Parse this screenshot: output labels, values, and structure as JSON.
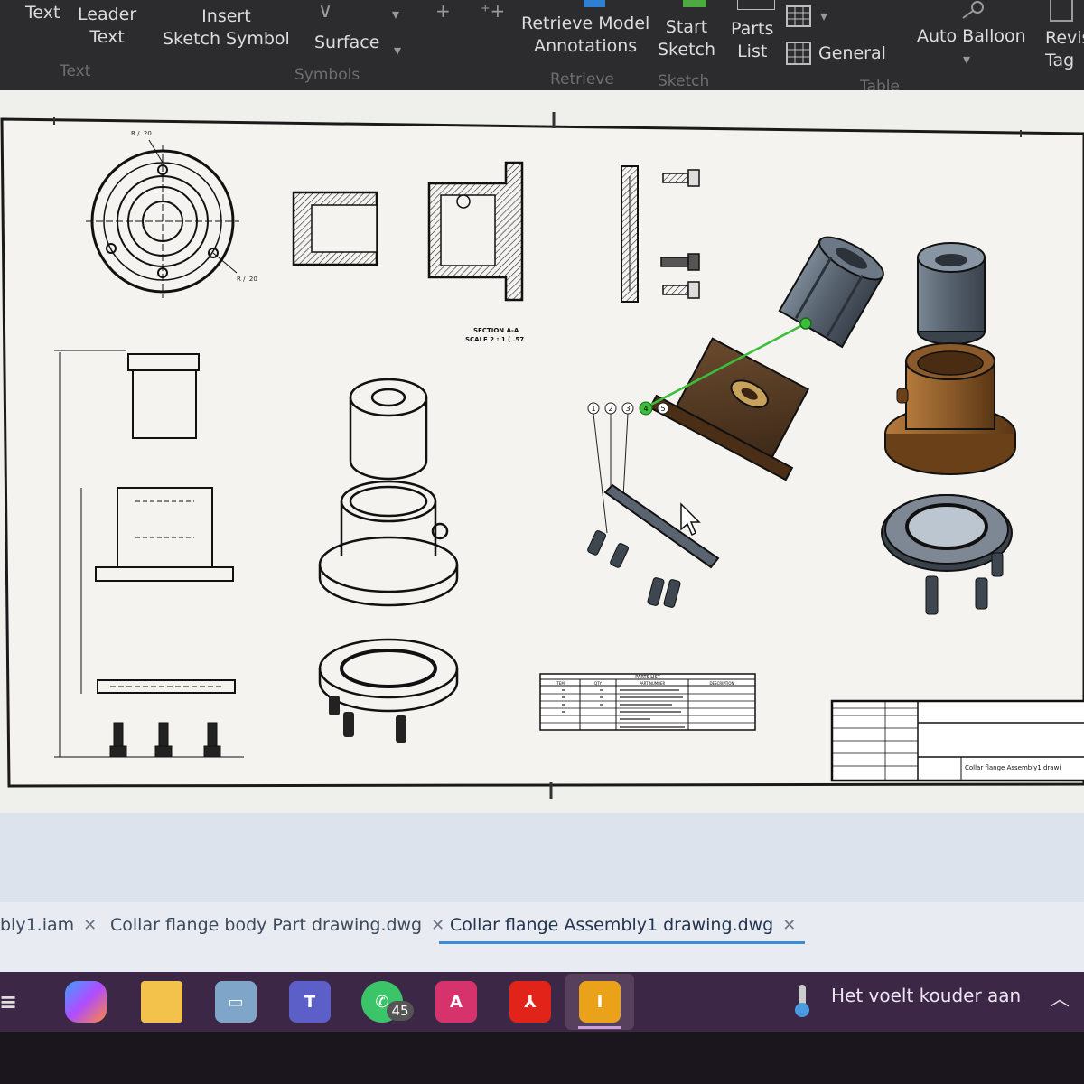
{
  "ribbon": {
    "text_label": "Text",
    "leader_text": [
      "Leader",
      "Text"
    ],
    "insert_sketch_symbol": [
      "Insert",
      "Sketch Symbol"
    ],
    "surface_label": "Surface",
    "retrieve_model_annotations": [
      "Retrieve Model",
      "Annotations"
    ],
    "start_sketch": [
      "Start",
      "Sketch"
    ],
    "parts_list": [
      "Parts",
      "List"
    ],
    "general_label": "General",
    "auto_balloon_label": "Auto Balloon",
    "revision_tag": [
      "Revis",
      "Tag"
    ],
    "groups": {
      "text": "Text",
      "symbols": "Symbols",
      "retrieve": "Retrieve",
      "sketch": "Sketch",
      "table": "Table"
    }
  },
  "drawing": {
    "section_caption": [
      "SECTION A-A",
      "SCALE 2 : 1 ( .57"
    ],
    "parts_list_title": "PARTS LIST",
    "parts_list_headers": [
      "ITEM",
      "QTY",
      "PART NUMBER",
      "DESCRIPTION"
    ],
    "title_block_name": "Collar flange Assembly1 drawi",
    "balloons": [
      "1",
      "2",
      "3",
      "4",
      "5"
    ],
    "colors": {
      "bronze": "#8a5a2a",
      "gray_part": "#55606c",
      "highlight": "#3bbf3b"
    }
  },
  "tabs": [
    {
      "label": "bly1.iam",
      "active": false
    },
    {
      "label": "Collar flange body Part drawing.dwg",
      "active": false
    },
    {
      "label": "Collar flange Assembly1 drawing.dwg",
      "active": true
    }
  ],
  "taskbar": {
    "whatsapp_badge": "45",
    "weather_text": "Het voelt kouder aan",
    "icons": [
      "widgets-icon",
      "copilot-icon",
      "file-explorer-icon",
      "remote-desktop-icon",
      "teams-icon",
      "whatsapp-icon",
      "autocad-icon",
      "acrobat-icon",
      "inventor-icon"
    ]
  }
}
